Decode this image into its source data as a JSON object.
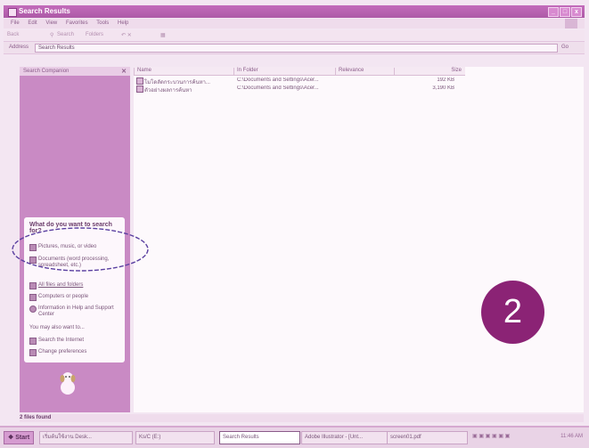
{
  "window": {
    "title": "Search Results",
    "controls": [
      "_",
      "□",
      "x"
    ]
  },
  "menu": [
    "File",
    "Edit",
    "View",
    "Favorites",
    "Tools",
    "Help"
  ],
  "toolbar": {
    "back": "Back",
    "search": "Search",
    "folders": "Folders"
  },
  "address": {
    "label": "Address",
    "value": "Search Results",
    "go": "Go"
  },
  "sidebar": {
    "header": "Search Companion",
    "panel_title": "What do you want to search for?",
    "options": [
      "Pictures, music, or video",
      "Documents (word processing, spreadsheet, etc.)",
      "All files and folders",
      "Computers or people",
      "Information in Help and Support Center"
    ],
    "also_label": "You may also want to...",
    "also_options": [
      "Search the Internet",
      "Change preferences"
    ]
  },
  "results": {
    "columns": [
      "Name",
      "In Folder",
      "Relevance",
      "Size"
    ],
    "rows": [
      {
        "name": "โมโดลัดกระบวนการค้นหา...",
        "folder": "C:\\Documents and Settings\\Acer...",
        "relevance": "",
        "size": "192 KB"
      },
      {
        "name": "ตัวอย่างผลการค้นหา",
        "folder": "C:\\Documents and Settings\\Acer...",
        "relevance": "",
        "size": "3,190 KB"
      }
    ]
  },
  "badge": "2",
  "status": "2 files found",
  "taskbar": {
    "start": "Start",
    "items": [
      "เริ่มต้นใช้งาน Desk...",
      "Ks/C (E:)",
      "Search Results",
      "Adobe Illustrator - [Unt...",
      "screen01.pdf"
    ],
    "clock": "11:46 AM"
  },
  "colors": {
    "titlebar": "#b55fae",
    "sidebar": "#c98ac4",
    "badge": "#8b2375",
    "annotation": "#5a3fa0"
  }
}
